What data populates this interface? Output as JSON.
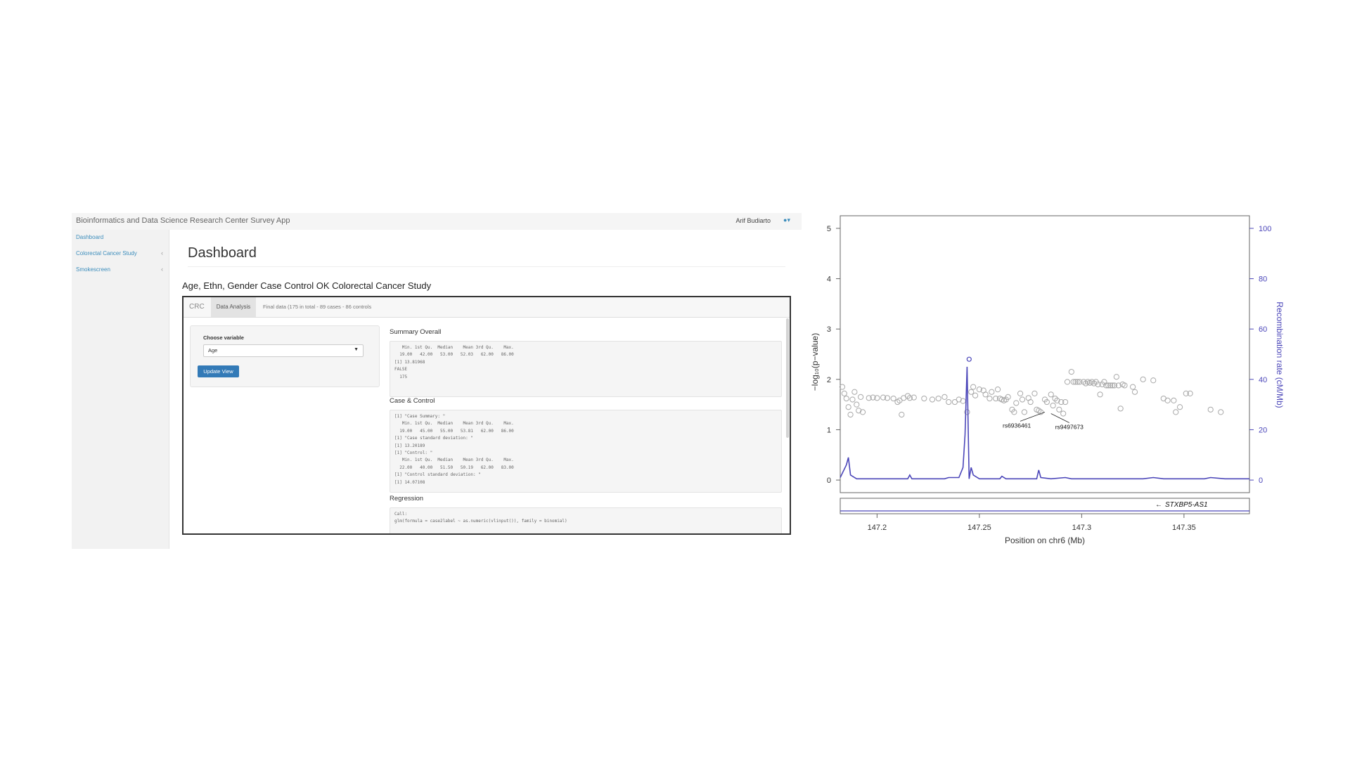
{
  "app": {
    "title": "Bioinformatics and Data Science Research Center Survey App",
    "user_name": "Arif Budiarto",
    "user_icon": "user-icon"
  },
  "sidebar": {
    "items": [
      {
        "label": "Dashboard",
        "chevron": ""
      },
      {
        "label": "Colorectal Cancer Study",
        "chevron": "‹"
      },
      {
        "label": "Smokescreen",
        "chevron": "‹"
      }
    ]
  },
  "main": {
    "page_title": "Dashboard",
    "study_title": "Age, Ethn, Gender Case Control OK Colorectal Cancer Study",
    "tabs": [
      {
        "label": "CRC"
      },
      {
        "label": "Data Analysis"
      },
      {
        "label": "Final data (175 in total - 89 cases - 86 controls"
      }
    ],
    "controls": {
      "choose_label": "Choose variable",
      "selected": "Age",
      "update_button": "Update View"
    },
    "summary_overall": {
      "title": "Summary Overall",
      "lines": [
        "   Min. 1st Qu.  Median    Mean 3rd Qu.    Max.",
        "  19.00   42.00   53.00   52.03   62.00   86.00",
        "[1] 13.81968",
        "",
        "FALSE",
        "  175"
      ]
    },
    "case_control": {
      "title": "Case & Control",
      "lines": [
        "[1] \"Case Summary: \"",
        "   Min. 1st Qu.  Median    Mean 3rd Qu.    Max.",
        "  19.00   45.00   55.00   53.81   62.00   86.00",
        "[1] \"Case standard deviation: \"",
        "[1] 13.20189",
        "[1] \"Control: \"",
        "   Min. 1st Qu.  Median    Mean 3rd Qu.    Max.",
        "  22.00   40.00   51.50   50.19   62.00   83.00",
        "[1] \"Control standard deviation: \"",
        "[1] 14.07108"
      ]
    },
    "regression": {
      "title": "Regression",
      "lines": [
        "",
        "Call:",
        "glm(formula = case2label ~ as.numeric(vlinput()), family = binomial)"
      ]
    }
  },
  "chart_data": {
    "type": "scatter",
    "title": "",
    "xlabel": "Position on chr6 (Mb)",
    "ylabel": "−log₁₀(p−value)",
    "y2label": "Recombination rate (cM/Mb)",
    "xlim": [
      147.182,
      147.382
    ],
    "ylim": [
      -0.25,
      5.25
    ],
    "y2lim": [
      -5,
      105
    ],
    "x_ticks": [
      "147.2",
      "147.25",
      "147.3",
      "147.35"
    ],
    "y_ticks": [
      "0",
      "1",
      "2",
      "3",
      "4",
      "5"
    ],
    "y2_ticks": [
      "0",
      "20",
      "40",
      "60",
      "80",
      "100"
    ],
    "colors": {
      "points": "#a8a8a8",
      "recomb": "#4b46b9",
      "lead": "#4b46b9"
    },
    "gene": {
      "label": "STXBP5-AS1",
      "direction": "←"
    },
    "annotations": [
      {
        "label": "rs6936461",
        "x": 147.282,
        "y": 1.35
      },
      {
        "label": "rs9497673",
        "x": 147.285,
        "y": 1.32
      }
    ],
    "lead_snp": {
      "x": 147.245,
      "y": 2.4
    },
    "points": [
      [
        147.183,
        1.85
      ],
      [
        147.184,
        1.72
      ],
      [
        147.185,
        1.62
      ],
      [
        147.186,
        1.45
      ],
      [
        147.187,
        1.3
      ],
      [
        147.188,
        1.6
      ],
      [
        147.189,
        1.75
      ],
      [
        147.19,
        1.5
      ],
      [
        147.191,
        1.38
      ],
      [
        147.192,
        1.65
      ],
      [
        147.193,
        1.35
      ],
      [
        147.196,
        1.63
      ],
      [
        147.198,
        1.64
      ],
      [
        147.2,
        1.63
      ],
      [
        147.203,
        1.64
      ],
      [
        147.205,
        1.63
      ],
      [
        147.208,
        1.62
      ],
      [
        147.21,
        1.55
      ],
      [
        147.211,
        1.58
      ],
      [
        147.212,
        1.3
      ],
      [
        147.213,
        1.63
      ],
      [
        147.215,
        1.67
      ],
      [
        147.216,
        1.63
      ],
      [
        147.218,
        1.64
      ],
      [
        147.223,
        1.62
      ],
      [
        147.227,
        1.6
      ],
      [
        147.23,
        1.62
      ],
      [
        147.233,
        1.65
      ],
      [
        147.235,
        1.55
      ],
      [
        147.238,
        1.55
      ],
      [
        147.24,
        1.6
      ],
      [
        147.242,
        1.57
      ],
      [
        147.244,
        1.35
      ],
      [
        147.246,
        1.75
      ],
      [
        147.247,
        1.85
      ],
      [
        147.248,
        1.68
      ],
      [
        147.25,
        1.8
      ],
      [
        147.252,
        1.78
      ],
      [
        147.253,
        1.7
      ],
      [
        147.255,
        1.62
      ],
      [
        147.256,
        1.75
      ],
      [
        147.258,
        1.62
      ],
      [
        147.259,
        1.8
      ],
      [
        147.26,
        1.62
      ],
      [
        147.261,
        1.6
      ],
      [
        147.262,
        1.58
      ],
      [
        147.263,
        1.6
      ],
      [
        147.264,
        1.65
      ],
      [
        147.266,
        1.4
      ],
      [
        147.267,
        1.35
      ],
      [
        147.268,
        1.53
      ],
      [
        147.27,
        1.72
      ],
      [
        147.271,
        1.6
      ],
      [
        147.272,
        1.35
      ],
      [
        147.274,
        1.63
      ],
      [
        147.275,
        1.55
      ],
      [
        147.277,
        1.72
      ],
      [
        147.278,
        1.4
      ],
      [
        147.279,
        1.38
      ],
      [
        147.28,
        1.35
      ],
      [
        147.282,
        1.6
      ],
      [
        147.283,
        1.55
      ],
      [
        147.285,
        1.7
      ],
      [
        147.286,
        1.48
      ],
      [
        147.287,
        1.62
      ],
      [
        147.288,
        1.58
      ],
      [
        147.289,
        1.4
      ],
      [
        147.29,
        1.55
      ],
      [
        147.291,
        1.32
      ],
      [
        147.292,
        1.55
      ],
      [
        147.293,
        1.95
      ],
      [
        147.295,
        2.15
      ],
      [
        147.296,
        1.95
      ],
      [
        147.297,
        1.95
      ],
      [
        147.298,
        1.95
      ],
      [
        147.299,
        1.95
      ],
      [
        147.301,
        1.95
      ],
      [
        147.302,
        1.92
      ],
      [
        147.303,
        1.95
      ],
      [
        147.304,
        1.93
      ],
      [
        147.305,
        1.95
      ],
      [
        147.306,
        1.92
      ],
      [
        147.307,
        1.95
      ],
      [
        147.308,
        1.9
      ],
      [
        147.309,
        1.7
      ],
      [
        147.31,
        1.9
      ],
      [
        147.311,
        1.95
      ],
      [
        147.312,
        1.88
      ],
      [
        147.313,
        1.88
      ],
      [
        147.314,
        1.88
      ],
      [
        147.315,
        1.88
      ],
      [
        147.316,
        1.88
      ],
      [
        147.317,
        2.05
      ],
      [
        147.318,
        1.88
      ],
      [
        147.319,
        1.42
      ],
      [
        147.32,
        1.9
      ],
      [
        147.321,
        1.88
      ],
      [
        147.325,
        1.85
      ],
      [
        147.326,
        1.75
      ],
      [
        147.33,
        2.0
      ],
      [
        147.335,
        1.98
      ],
      [
        147.34,
        1.62
      ],
      [
        147.342,
        1.58
      ],
      [
        147.345,
        1.58
      ],
      [
        147.346,
        1.35
      ],
      [
        147.348,
        1.45
      ],
      [
        147.351,
        1.72
      ],
      [
        147.353,
        1.72
      ],
      [
        147.363,
        1.4
      ],
      [
        147.368,
        1.35
      ]
    ],
    "recombination": [
      [
        147.182,
        1
      ],
      [
        147.185,
        6
      ],
      [
        147.186,
        9
      ],
      [
        147.187,
        2
      ],
      [
        147.19,
        0.5
      ],
      [
        147.215,
        0.5
      ],
      [
        147.216,
        2
      ],
      [
        147.217,
        0.5
      ],
      [
        147.233,
        0.5
      ],
      [
        147.235,
        1
      ],
      [
        147.24,
        1
      ],
      [
        147.242,
        5
      ],
      [
        147.243,
        18
      ],
      [
        147.244,
        45
      ],
      [
        147.245,
        0.5
      ],
      [
        147.246,
        5
      ],
      [
        147.247,
        2
      ],
      [
        147.25,
        0.5
      ],
      [
        147.26,
        0.5
      ],
      [
        147.261,
        1.5
      ],
      [
        147.263,
        0.5
      ],
      [
        147.278,
        0.5
      ],
      [
        147.279,
        4
      ],
      [
        147.28,
        1
      ],
      [
        147.285,
        0.5
      ],
      [
        147.292,
        1
      ],
      [
        147.295,
        0.5
      ],
      [
        147.33,
        0.5
      ],
      [
        147.335,
        1
      ],
      [
        147.34,
        0.5
      ],
      [
        147.36,
        0.5
      ],
      [
        147.363,
        1
      ],
      [
        147.37,
        0.5
      ],
      [
        147.382,
        0.5
      ]
    ]
  }
}
